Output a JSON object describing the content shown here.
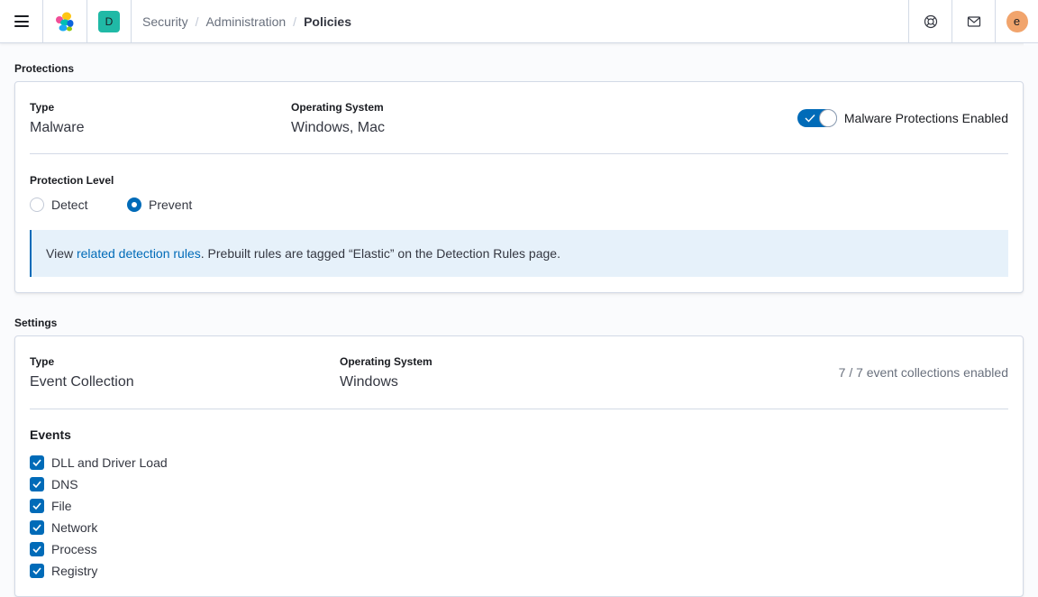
{
  "header": {
    "space_initial": "D",
    "breadcrumbs": [
      "Security",
      "Administration",
      "Policies"
    ],
    "avatar_initial": "e"
  },
  "protections": {
    "section_title": "Protections",
    "type_label": "Type",
    "type_value": "Malware",
    "os_label": "Operating System",
    "os_value": "Windows, Mac",
    "toggle_label": "Malware Protections Enabled",
    "toggle_on": true,
    "level_label": "Protection Level",
    "levels": [
      {
        "label": "Detect",
        "selected": false
      },
      {
        "label": "Prevent",
        "selected": true
      }
    ],
    "callout_prefix": "View ",
    "callout_link": "related detection rules",
    "callout_suffix": ". Prebuilt rules are tagged “Elastic” on the Detection Rules page."
  },
  "settings": {
    "section_title": "Settings",
    "type_label": "Type",
    "type_value": "Event Collection",
    "os_label": "Operating System",
    "os_value": "Windows",
    "count_text": "7 / 7 event collections enabled",
    "events_title": "Events",
    "events": [
      {
        "label": "DLL and Driver Load",
        "checked": true
      },
      {
        "label": "DNS",
        "checked": true
      },
      {
        "label": "File",
        "checked": true
      },
      {
        "label": "Network",
        "checked": true
      },
      {
        "label": "Process",
        "checked": true
      },
      {
        "label": "Registry",
        "checked": true
      }
    ]
  },
  "colors": {
    "primary": "#006bb8",
    "space_badge": "#20b9a6",
    "avatar": "#f1a46c",
    "callout_bg": "#e6f1fa"
  },
  "icons": {
    "menu": "hamburger-icon",
    "logo": "elastic-logo-icon",
    "help": "lifebuoy-icon",
    "news": "mail-icon"
  }
}
